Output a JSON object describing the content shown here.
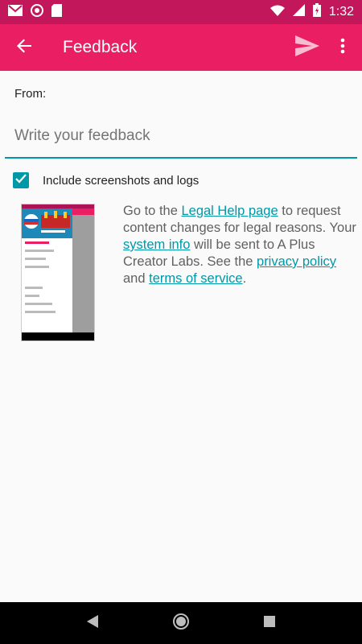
{
  "status_bar": {
    "time": "1:32",
    "icons": [
      "gmail-icon",
      "app-icon",
      "sd-card-icon",
      "wifi-icon",
      "signal-icon",
      "battery-charging-icon"
    ]
  },
  "app_bar": {
    "title": "Feedback",
    "icons": [
      "back-arrow-icon",
      "send-icon",
      "more-vert-icon"
    ]
  },
  "form": {
    "from_label": "From:",
    "feedback_placeholder": "Write your feedback",
    "include_label": "Include screenshots and logs",
    "include_checked": true
  },
  "legal": {
    "part1": "Go to the ",
    "legal_help_link": "Legal Help page",
    "part2": " to request content changes for legal reasons. Your ",
    "system_info_link": "system info",
    "part3": " will be sent to A Plus Creator Labs. See the ",
    "privacy_link": "privacy policy",
    "part4": " and ",
    "terms_link": "terms of service",
    "part5": "."
  },
  "colors": {
    "status_bar": "#c2185b",
    "app_bar": "#e91e63",
    "accent": "#0097a7"
  }
}
